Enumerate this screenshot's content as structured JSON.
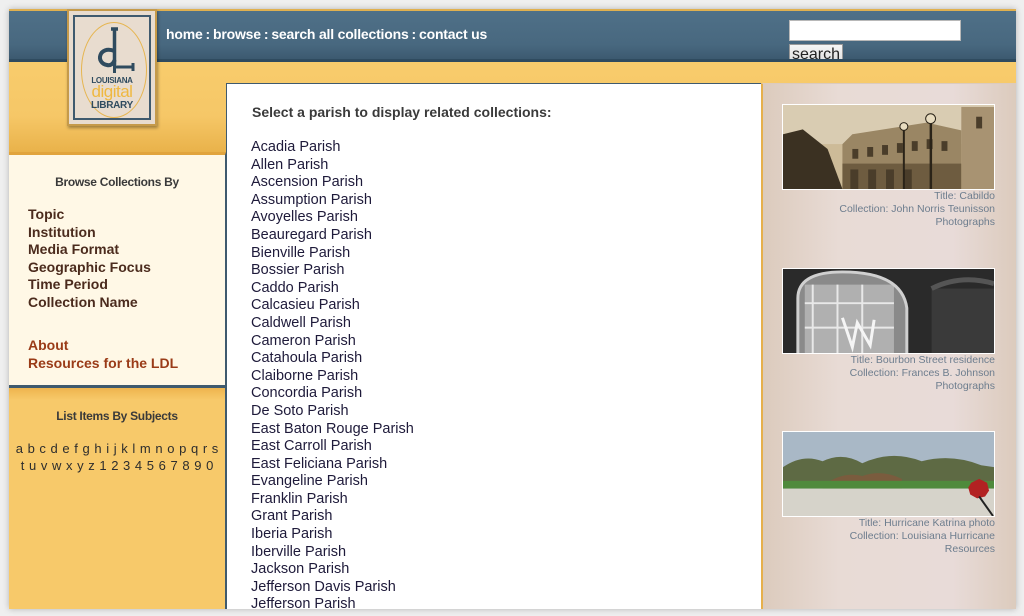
{
  "header": {
    "logo": {
      "line1": "LOUISIANA",
      "line2": "digital",
      "line3": "LIBRARY"
    },
    "nav": [
      {
        "label": "home"
      },
      {
        "label": "browse"
      },
      {
        "label": "search all collections"
      },
      {
        "label": "contact us"
      }
    ],
    "nav_separator": ":",
    "search": {
      "value": "",
      "placeholder": "",
      "button_label": "search"
    }
  },
  "sidebar": {
    "browse_title": "Browse Collections By",
    "browse_items": [
      {
        "label": "Topic"
      },
      {
        "label": "Institution"
      },
      {
        "label": "Media Format"
      },
      {
        "label": "Geographic Focus"
      },
      {
        "label": "Time Period"
      },
      {
        "label": "Collection Name"
      }
    ],
    "extra_links": [
      {
        "label": "About"
      },
      {
        "label": "Resources for the LDL"
      }
    ],
    "subjects_title": "List Items By Subjects",
    "letters_row1": [
      "a",
      "b",
      "c",
      "d",
      "e",
      "f",
      "g",
      "h",
      "i",
      "j",
      "k",
      "l",
      "m",
      "n",
      "o",
      "p",
      "q",
      "r",
      "s"
    ],
    "letters_row2": [
      "t",
      "u",
      "v",
      "w",
      "x",
      "y",
      "z",
      "1",
      "2",
      "3",
      "4",
      "5",
      "6",
      "7",
      "8",
      "9",
      "0"
    ]
  },
  "main": {
    "heading": "Select a parish to display related collections:",
    "parishes": [
      "Acadia Parish",
      "Allen Parish",
      "Ascension Parish",
      "Assumption Parish",
      "Avoyelles Parish",
      "Beauregard Parish",
      "Bienville Parish",
      "Bossier Parish",
      "Caddo Parish",
      "Calcasieu Parish",
      "Caldwell Parish",
      "Cameron Parish",
      "Catahoula Parish",
      "Claiborne Parish",
      "Concordia Parish",
      "De Soto Parish",
      "East Baton Rouge Parish",
      "East Carroll Parish",
      "East Feliciana Parish",
      "Evangeline Parish",
      "Franklin Parish",
      "Grant Parish",
      "Iberia Parish",
      "Iberville Parish",
      "Jackson Parish",
      "Jefferson Davis Parish",
      "Jefferson Parish"
    ]
  },
  "features": [
    {
      "title": "Title: Cabildo",
      "collection_line1": "Collection: John Norris Teunisson",
      "collection_line2": "Photographs",
      "image": "sepia-building-photo"
    },
    {
      "title": "Title: Bourbon Street residence",
      "collection_line1": "Collection: Frances B. Johnson",
      "collection_line2": "Photographs",
      "image": "courtyard-bw-photo"
    },
    {
      "title": "Title: Hurricane Katrina photo",
      "collection_line1": "Collection: Louisiana Hurricane",
      "collection_line2": "Resources",
      "image": "hurricane-landscape-photo"
    }
  ],
  "colors": {
    "header_blue": "#48687f",
    "gold": "#f7c96a",
    "browse_link": "#4b2b1d",
    "accent_link": "#9a3b17",
    "caption": "#6d7d8e"
  }
}
